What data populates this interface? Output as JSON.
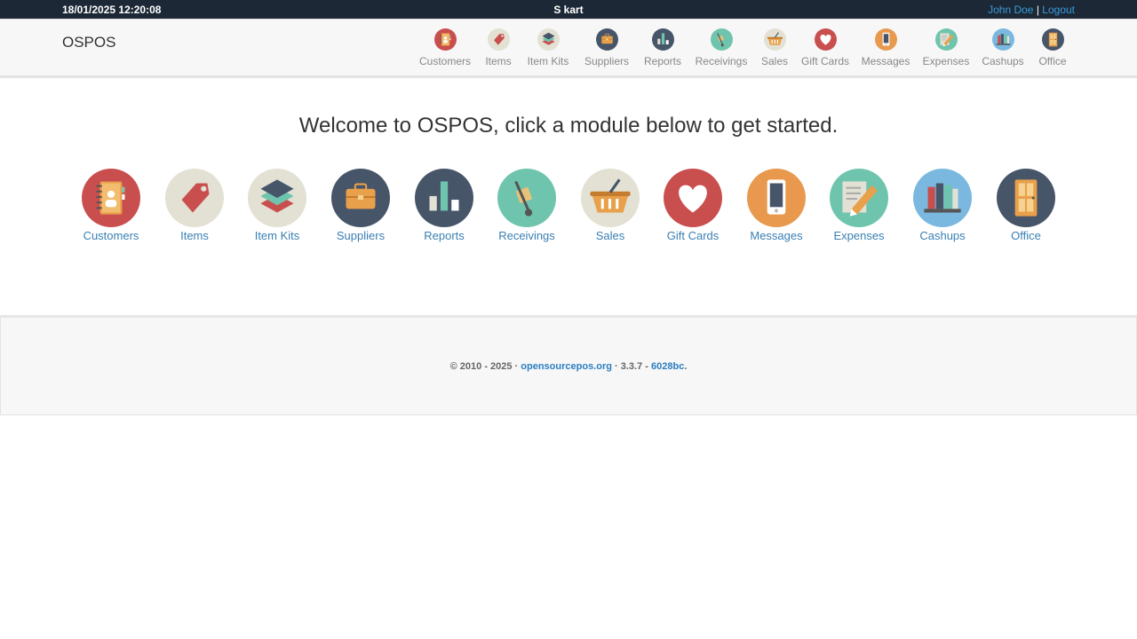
{
  "topbar": {
    "datetime": "18/01/2025 12:20:08",
    "store_name": "S kart",
    "user_name": "John Doe",
    "separator": "|",
    "logout_label": "Logout"
  },
  "navbar": {
    "brand": "OSPOS",
    "items": [
      {
        "label": "Customers",
        "icon": "customers-icon"
      },
      {
        "label": "Items",
        "icon": "items-icon"
      },
      {
        "label": "Item Kits",
        "icon": "item-kits-icon"
      },
      {
        "label": "Suppliers",
        "icon": "suppliers-icon"
      },
      {
        "label": "Reports",
        "icon": "reports-icon"
      },
      {
        "label": "Receivings",
        "icon": "receivings-icon"
      },
      {
        "label": "Sales",
        "icon": "sales-icon"
      },
      {
        "label": "Gift Cards",
        "icon": "gift-cards-icon"
      },
      {
        "label": "Messages",
        "icon": "messages-icon"
      },
      {
        "label": "Expenses",
        "icon": "expenses-icon"
      },
      {
        "label": "Cashups",
        "icon": "cashups-icon"
      },
      {
        "label": "Office",
        "icon": "office-icon"
      }
    ]
  },
  "main": {
    "welcome": "Welcome to OSPOS, click a module below to get started.",
    "modules": [
      {
        "label": "Customers"
      },
      {
        "label": "Items"
      },
      {
        "label": "Item Kits"
      },
      {
        "label": "Suppliers"
      },
      {
        "label": "Reports"
      },
      {
        "label": "Receivings"
      },
      {
        "label": "Sales"
      },
      {
        "label": "Gift Cards"
      },
      {
        "label": "Messages"
      },
      {
        "label": "Expenses"
      },
      {
        "label": "Cashups"
      },
      {
        "label": "Office"
      }
    ]
  },
  "footer": {
    "copyright": "© 2010 - 2025 · ",
    "site_link": "opensourcepos.org",
    "version": " · 3.3.7 - ",
    "commit_link": "6028bc",
    "end": "."
  },
  "colors": {
    "topbar_bg": "#1c2836",
    "link_blue": "#3a7fb3",
    "navbar_bg": "#f7f7f7"
  }
}
